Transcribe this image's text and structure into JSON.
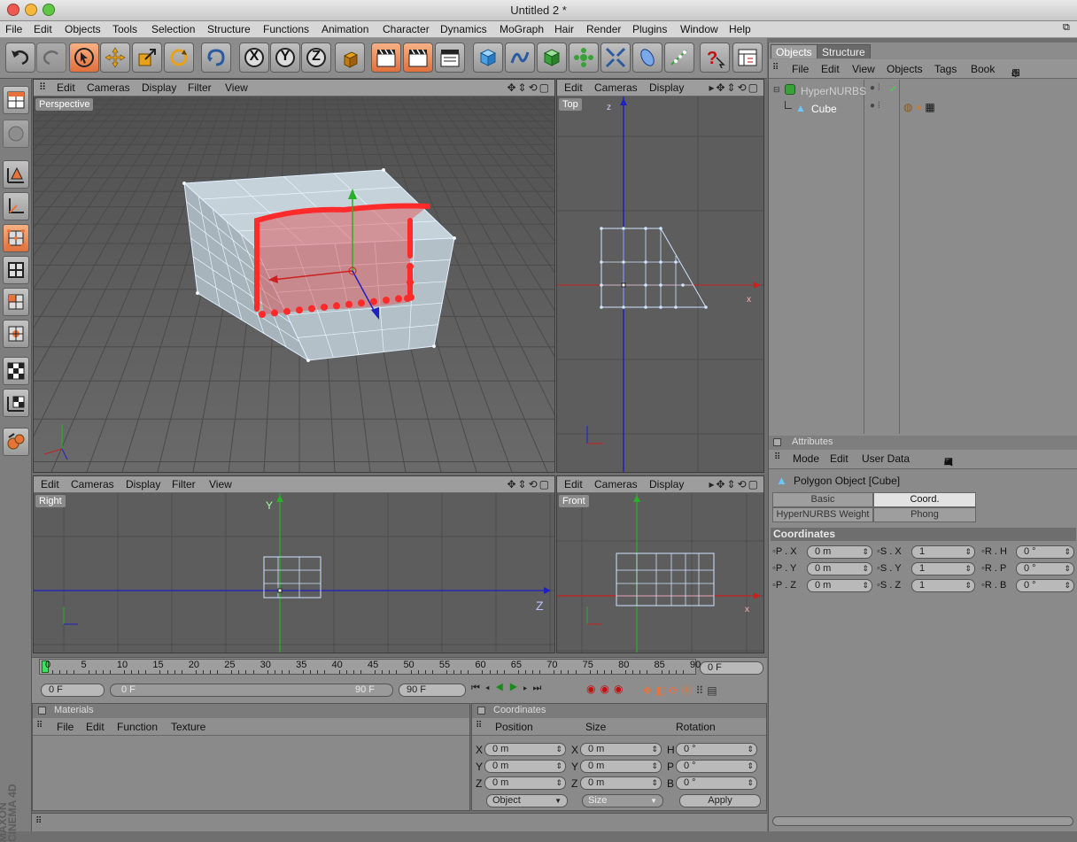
{
  "window": {
    "title": "Untitled 2 *"
  },
  "menu": [
    "File",
    "Edit",
    "Objects",
    "Tools",
    "Selection",
    "Structure",
    "Functions",
    "Animation",
    "Character",
    "Dynamics",
    "MoGraph",
    "Hair",
    "Render",
    "Plugins",
    "Window",
    "Help"
  ],
  "viewport_menu": [
    "Edit",
    "Cameras",
    "Display",
    "Filter",
    "View"
  ],
  "viewport_menu_short": [
    "Edit",
    "Cameras",
    "Display"
  ],
  "viewports": {
    "perspective": "Perspective",
    "top": "Top",
    "right": "Right",
    "front": "Front"
  },
  "toolbar": {
    "x_label": "X",
    "y_label": "Y",
    "z_label": "Z"
  },
  "axes": {
    "x": "x",
    "y": "Y",
    "z": "Z",
    "z_lower": "z"
  },
  "timeline": {
    "ticks": [
      "0",
      "5",
      "10",
      "15",
      "20",
      "25",
      "30",
      "35",
      "40",
      "45",
      "50",
      "55",
      "60",
      "65",
      "70",
      "75",
      "80",
      "85",
      "90"
    ],
    "current_frame": "0 F",
    "start": "0 F",
    "range_start": "0 F",
    "range_end": "90 F",
    "end": "90 F"
  },
  "materials": {
    "title": "Materials",
    "menu": [
      "File",
      "Edit",
      "Function",
      "Texture"
    ]
  },
  "coordinates_panel": {
    "title": "Coordinates",
    "headers": [
      "Position",
      "Size",
      "Rotation"
    ],
    "rows": [
      {
        "pl": "X",
        "pv": "0 m",
        "sl": "X",
        "sv": "0 m",
        "rl": "H",
        "rv": "0 °"
      },
      {
        "pl": "Y",
        "pv": "0 m",
        "sl": "Y",
        "sv": "0 m",
        "rl": "P",
        "rv": "0 °"
      },
      {
        "pl": "Z",
        "pv": "0 m",
        "sl": "Z",
        "sv": "0 m",
        "rl": "B",
        "rv": "0 °"
      }
    ],
    "mode_select": "Object",
    "size_select": "Size",
    "apply": "Apply"
  },
  "objects_panel": {
    "tabs": [
      "Objects",
      "Structure"
    ],
    "menu": [
      "File",
      "Edit",
      "View",
      "Objects",
      "Tags",
      "Book"
    ],
    "items": [
      "HyperNURBS",
      "Cube"
    ]
  },
  "attributes": {
    "title": "Attributes",
    "menu": [
      "Mode",
      "Edit",
      "User Data"
    ],
    "object_title": "Polygon Object [Cube]",
    "tabs": [
      "Basic",
      "Coord.",
      "HyperNURBS Weight",
      "Phong"
    ],
    "section": "Coordinates",
    "rows": [
      {
        "pl": "P . X",
        "pv": "0 m",
        "sl": "S . X",
        "sv": "1",
        "rl": "R . H",
        "rv": "0 °"
      },
      {
        "pl": "P . Y",
        "pv": "0 m",
        "sl": "S . Y",
        "sv": "1",
        "rl": "R . P",
        "rv": "0 °"
      },
      {
        "pl": "P . Z",
        "pv": "0 m",
        "sl": "S . Z",
        "sv": "1",
        "rl": "R . B",
        "rv": "0 °"
      }
    ]
  },
  "brand": {
    "line1": "MAXON",
    "line2": "CINEMA 4D"
  },
  "colors": {
    "accent": "#e8733a",
    "selection": "#ff3b30",
    "axis_x": "#cc2020",
    "axis_y": "#20a020",
    "axis_z": "#2020c0"
  }
}
